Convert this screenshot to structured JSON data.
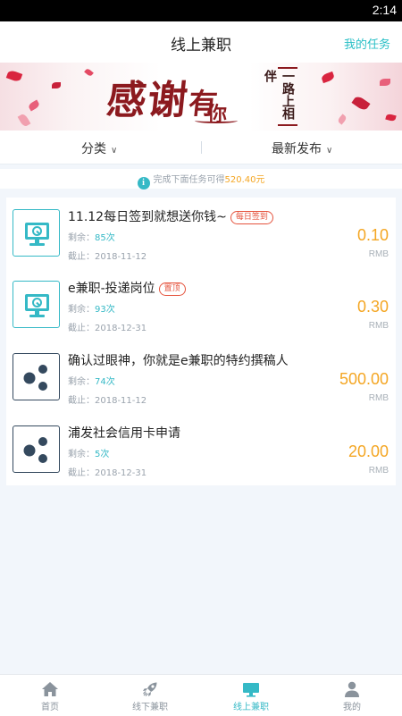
{
  "status_bar": {
    "time": "2:14"
  },
  "header": {
    "title": "线上兼职",
    "action": "我的任务"
  },
  "banner": {
    "main_text": "感谢",
    "main_text_2": "有",
    "sub_text": "你",
    "vertical_text": "一路上相伴"
  },
  "filters": {
    "category": {
      "label": "分类",
      "icon": "chevron-down-icon"
    },
    "sort": {
      "label": "最新发布",
      "icon": "chevron-down-icon"
    }
  },
  "notice": {
    "icon": "info-icon",
    "text": "完成下面任务可得",
    "amount": "520.40元"
  },
  "tasks": [
    {
      "title": "11.12每日签到就想送你钱~",
      "tag": "每日签到",
      "remain_label": "剩余：",
      "remain": "85次",
      "deadline": "截止：2018-11-12",
      "price": "0.10",
      "unit": "RMB",
      "icon": "monitor-icon",
      "icon_color": "#35b9c6"
    },
    {
      "title": "e兼职-投递岗位",
      "tag": "置顶",
      "remain_label": "剩余：",
      "remain": "93次",
      "deadline": "截止：2018-12-31",
      "price": "0.30",
      "unit": "RMB",
      "icon": "monitor-icon",
      "icon_color": "#35b9c6"
    },
    {
      "title": "确认过眼神，你就是e兼职的特约撰稿人",
      "tag": "",
      "remain_label": "剩余：",
      "remain": "74次",
      "deadline": "截止：2018-11-12",
      "price": "500.00",
      "unit": "RMB",
      "icon": "share-dots-icon",
      "icon_color": "#34495e"
    },
    {
      "title": "浦发社会信用卡申请",
      "tag": "",
      "remain_label": "剩余：",
      "remain": "5次",
      "deadline": "截止：2018-12-31",
      "price": "20.00",
      "unit": "RMB",
      "icon": "share-dots-icon",
      "icon_color": "#34495e"
    }
  ],
  "tabbar": [
    {
      "label": "首页",
      "icon": "home-icon",
      "active": false
    },
    {
      "label": "线下兼职",
      "icon": "rocket-icon",
      "active": false
    },
    {
      "label": "线上兼职",
      "icon": "monitor-icon",
      "active": true
    },
    {
      "label": "我的",
      "icon": "user-icon",
      "active": false
    }
  ],
  "colors": {
    "accent": "#35b9c6",
    "price": "#f4a623",
    "tag": "#e5533d",
    "banner_text": "#8c1a1f"
  }
}
